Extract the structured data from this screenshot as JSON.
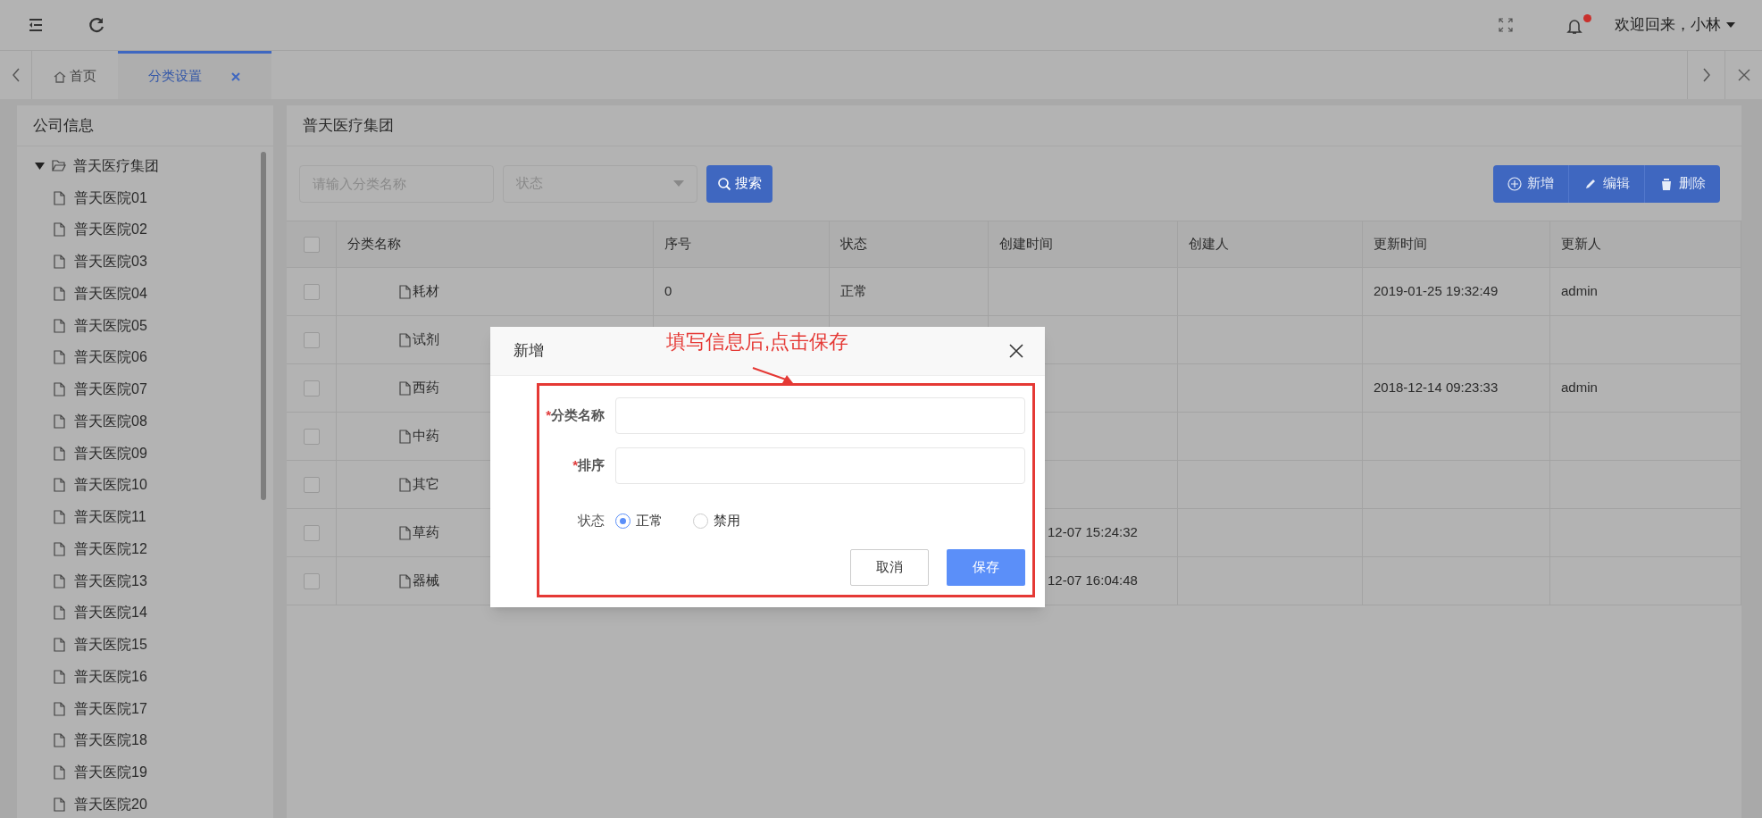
{
  "top_bar": {
    "user": "欢迎回来，小林",
    "notification_dot": true
  },
  "tabs": [
    {
      "label": "首页",
      "kind": "home",
      "selected": false
    },
    {
      "label": "分类设置",
      "kind": "closable",
      "selected": true
    }
  ],
  "sidebar": {
    "title": "公司信息",
    "tree": [
      {
        "label": "普天医疗集团",
        "expanded": true,
        "children": [
          {
            "label": "普天医院01"
          },
          {
            "label": "普天医院02"
          },
          {
            "label": "普天医院03"
          },
          {
            "label": "普天医院04"
          },
          {
            "label": "普天医院05"
          },
          {
            "label": "普天医院06"
          },
          {
            "label": "普天医院07"
          },
          {
            "label": "普天医院08"
          },
          {
            "label": "普天医院09"
          },
          {
            "label": "普天医院10"
          },
          {
            "label": "普天医院11"
          },
          {
            "label": "普天医院12"
          },
          {
            "label": "普天医院13"
          },
          {
            "label": "普天医院14"
          },
          {
            "label": "普天医院15"
          },
          {
            "label": "普天医院16"
          },
          {
            "label": "普天医院17"
          },
          {
            "label": "普天医院18"
          },
          {
            "label": "普天医院19"
          },
          {
            "label": "普天医院20"
          }
        ]
      }
    ]
  },
  "main": {
    "title": "普天医疗集团",
    "search": {
      "placeholder": "请输入分类名称"
    },
    "status_select": {
      "placeholder": "状态"
    },
    "search_button": "搜索",
    "actions": [
      {
        "kind": "add",
        "label": "新增"
      },
      {
        "kind": "edit",
        "label": "编辑"
      },
      {
        "kind": "delete",
        "label": "删除"
      }
    ],
    "table": {
      "header_checked": false,
      "columns": [
        "分类名称",
        "序号",
        "状态",
        "创建时间",
        "创建人",
        "更新时间",
        "更新人"
      ],
      "rows": [
        {
          "checked": false,
          "name": "耗材",
          "order": "0",
          "status": "正常",
          "updated": "2019-01-25 19:32:49",
          "updater": "admin"
        },
        {
          "checked": false,
          "name": "试剂"
        },
        {
          "checked": false,
          "name": "西药",
          "updated": "2018-12-14 09:23:33",
          "updater": "admin"
        },
        {
          "checked": false,
          "name": "中药"
        },
        {
          "checked": false,
          "name": "其它"
        },
        {
          "checked": false,
          "name": "草药",
          "created": "12-07 15:24:32"
        },
        {
          "checked": false,
          "name": "器械",
          "created": "12-07 16:04:48"
        }
      ]
    }
  },
  "dialog": {
    "title": "新增",
    "fields": [
      {
        "kind": "text",
        "required_mark": "*",
        "label": "分类名称"
      },
      {
        "kind": "text",
        "required_mark": "*",
        "label": "排序"
      },
      {
        "kind": "radio",
        "label": "状态",
        "options": [
          {
            "label": "正常",
            "selected": true
          },
          {
            "label": "禁用",
            "selected": false
          }
        ]
      }
    ],
    "buttons": [
      {
        "kind": "secondary",
        "label": "取消"
      },
      {
        "kind": "primary",
        "label": "保存"
      }
    ]
  },
  "annotation": {
    "text": "填写信息后,点击保存"
  }
}
